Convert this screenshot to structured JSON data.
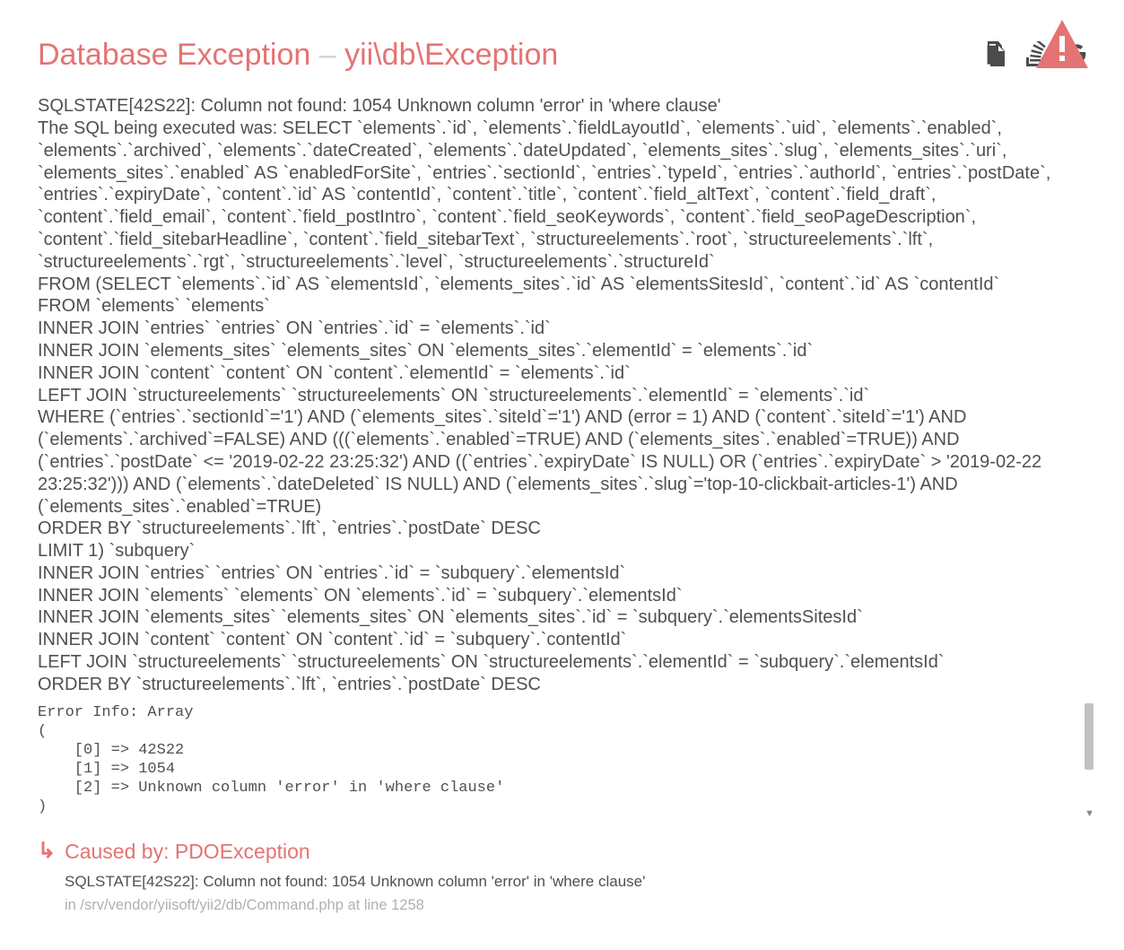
{
  "title": {
    "main": "Database Exception",
    "dash": " – ",
    "class": "yii\\db\\Exception"
  },
  "icons": {
    "copy": "copy-icon",
    "stackoverflow": "stackoverflow-icon",
    "google": "google-icon",
    "warning": "warning-icon"
  },
  "message": "SQLSTATE[42S22]: Column not found: 1054 Unknown column 'error' in 'where clause'\nThe SQL being executed was: SELECT `elements`.`id`, `elements`.`fieldLayoutId`, `elements`.`uid`, `elements`.`enabled`, `elements`.`archived`, `elements`.`dateCreated`, `elements`.`dateUpdated`, `elements_sites`.`slug`, `elements_sites`.`uri`, `elements_sites`.`enabled` AS `enabledForSite`, `entries`.`sectionId`, `entries`.`typeId`, `entries`.`authorId`, `entries`.`postDate`, `entries`.`expiryDate`, `content`.`id` AS `contentId`, `content`.`title`, `content`.`field_altText`, `content`.`field_draft`, `content`.`field_email`, `content`.`field_postIntro`, `content`.`field_seoKeywords`, `content`.`field_seoPageDescription`, `content`.`field_sitebarHeadline`, `content`.`field_sitebarText`, `structureelements`.`root`, `structureelements`.`lft`, `structureelements`.`rgt`, `structureelements`.`level`, `structureelements`.`structureId`\nFROM (SELECT `elements`.`id` AS `elementsId`, `elements_sites`.`id` AS `elementsSitesId`, `content`.`id` AS `contentId`\nFROM `elements` `elements`\nINNER JOIN `entries` `entries` ON `entries`.`id` = `elements`.`id`\nINNER JOIN `elements_sites` `elements_sites` ON `elements_sites`.`elementId` = `elements`.`id`\nINNER JOIN `content` `content` ON `content`.`elementId` = `elements`.`id`\nLEFT JOIN `structureelements` `structureelements` ON `structureelements`.`elementId` = `elements`.`id`\nWHERE (`entries`.`sectionId`='1') AND (`elements_sites`.`siteId`='1') AND (error = 1) AND (`content`.`siteId`='1') AND (`elements`.`archived`=FALSE) AND (((`elements`.`enabled`=TRUE) AND (`elements_sites`.`enabled`=TRUE)) AND (`entries`.`postDate` <= '2019-02-22 23:25:32') AND ((`entries`.`expiryDate` IS NULL) OR (`entries`.`expiryDate` > '2019-02-22 23:25:32'))) AND (`elements`.`dateDeleted` IS NULL) AND (`elements_sites`.`slug`='top-10-clickbait-articles-1') AND (`elements_sites`.`enabled`=TRUE)\nORDER BY `structureelements`.`lft`, `entries`.`postDate` DESC\nLIMIT 1) `subquery`\nINNER JOIN `entries` `entries` ON `entries`.`id` = `subquery`.`elementsId`\nINNER JOIN `elements` `elements` ON `elements`.`id` = `subquery`.`elementsId`\nINNER JOIN `elements_sites` `elements_sites` ON `elements_sites`.`id` = `subquery`.`elementsSitesId`\nINNER JOIN `content` `content` ON `content`.`id` = `subquery`.`contentId`\nLEFT JOIN `structureelements` `structureelements` ON `structureelements`.`elementId` = `subquery`.`elementsId`\nORDER BY `structureelements`.`lft`, `entries`.`postDate` DESC",
  "error_info": "Error Info: Array\n(\n    [0] => 42S22\n    [1] => 1054\n    [2] => Unknown column 'error' in 'where clause'\n)",
  "caused_by": {
    "prefix": "Caused by: ",
    "exception": "PDOException",
    "message": "SQLSTATE[42S22]: Column not found: 1054 Unknown column 'error' in 'where clause'",
    "file": "in /srv/vendor/yiisoft/yii2/db/Command.php at line 1258"
  }
}
